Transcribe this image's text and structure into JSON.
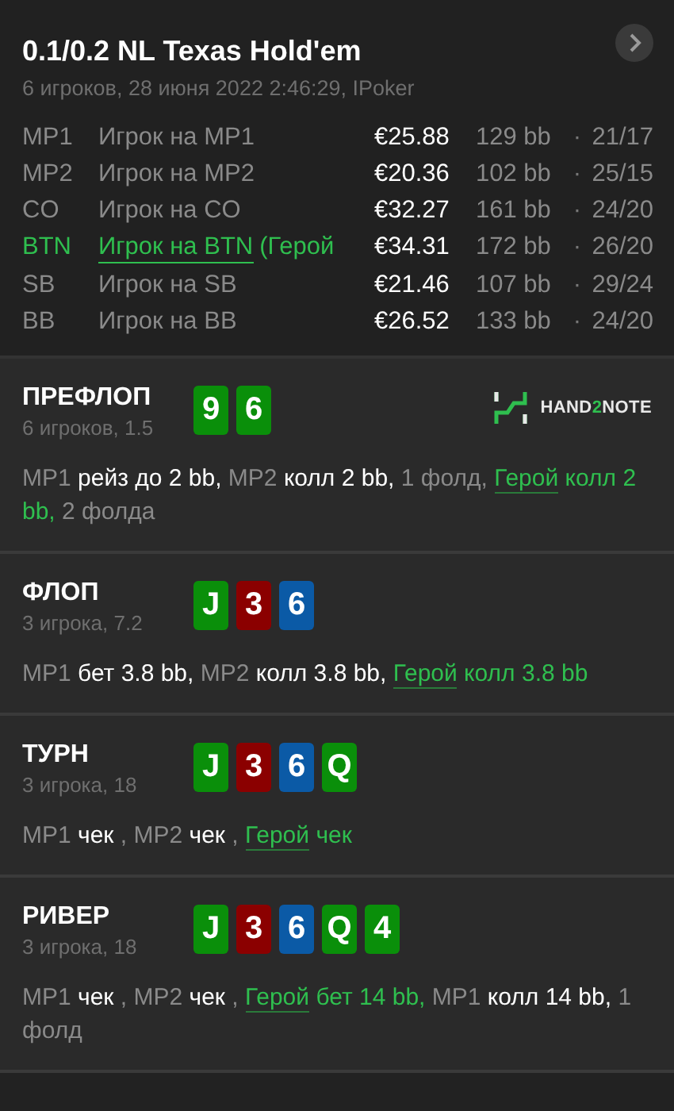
{
  "header": {
    "title": "0.1/0.2 NL Texas Hold'em",
    "subtitle": "6 игроков, 28 июня 2022 2:46:29, IPoker"
  },
  "players": [
    {
      "position": "MP1",
      "name": "Игрок на MP1",
      "hero": false,
      "stack": "€25.88",
      "bb": "129 bb",
      "sep": "·",
      "stats": "21/17"
    },
    {
      "position": "MP2",
      "name": "Игрок на MP2",
      "hero": false,
      "stack": "€20.36",
      "bb": "102 bb",
      "sep": "·",
      "stats": "25/15"
    },
    {
      "position": "CO",
      "name": "Игрок на CO",
      "hero": false,
      "stack": "€32.27",
      "bb": "161 bb",
      "sep": "·",
      "stats": "24/20"
    },
    {
      "position": "BTN",
      "name": "Игрок на BTN",
      "tag": "(Герой",
      "hero": true,
      "stack": "€34.31",
      "bb": "172 bb",
      "sep": "·",
      "stats": "26/20"
    },
    {
      "position": "SB",
      "name": "Игрок на SB",
      "hero": false,
      "stack": "€21.46",
      "bb": "107 bb",
      "sep": "·",
      "stats": "29/24"
    },
    {
      "position": "BB",
      "name": "Игрок на BB",
      "hero": false,
      "stack": "€26.52",
      "bb": "133 bb",
      "sep": "·",
      "stats": "24/20"
    }
  ],
  "streets": [
    {
      "title": "ПРЕФЛОП",
      "subtitle": "6 игроков, 1.5",
      "cards": [
        {
          "rank": "9",
          "color": "#0a8f0a"
        },
        {
          "rank": "6",
          "color": "#0a8f0a"
        }
      ],
      "logo": {
        "prefix": "HAND",
        "accent": "2",
        "suffix": "NOTE"
      },
      "actions": [
        {
          "kind": "seat",
          "text": "MP1 "
        },
        {
          "kind": "move",
          "text": "рейз до 2 bb,"
        },
        {
          "kind": "seat",
          "text": " MP2 "
        },
        {
          "kind": "move",
          "text": "колл 2 bb,"
        },
        {
          "kind": "fold",
          "text": " 1 фолд, "
        },
        {
          "kind": "hero-link",
          "text": "Герой"
        },
        {
          "kind": "hero",
          "text": " колл 2 bb,"
        },
        {
          "kind": "fold",
          "text": " 2 фолда"
        }
      ]
    },
    {
      "title": "ФЛОП",
      "subtitle": "3 игрока, 7.2",
      "cards": [
        {
          "rank": "J",
          "color": "#0a8f0a"
        },
        {
          "rank": "3",
          "color": "#8b0000"
        },
        {
          "rank": "6",
          "color": "#0b5aa6"
        }
      ],
      "actions": [
        {
          "kind": "seat",
          "text": "MP1 "
        },
        {
          "kind": "move",
          "text": "бет 3.8 bb,"
        },
        {
          "kind": "seat",
          "text": " MP2 "
        },
        {
          "kind": "move",
          "text": "колл 3.8 bb, "
        },
        {
          "kind": "hero-link",
          "text": "Герой"
        },
        {
          "kind": "hero",
          "text": " колл 3.8 bb"
        }
      ]
    },
    {
      "title": "ТУРН",
      "subtitle": "3 игрока, 18",
      "cards": [
        {
          "rank": "J",
          "color": "#0a8f0a"
        },
        {
          "rank": "3",
          "color": "#8b0000"
        },
        {
          "rank": "6",
          "color": "#0b5aa6"
        },
        {
          "rank": "Q",
          "color": "#0a8f0a"
        }
      ],
      "actions": [
        {
          "kind": "seat",
          "text": "MP1 "
        },
        {
          "kind": "move",
          "text": "чек "
        },
        {
          "kind": "seat",
          "text": ", MP2 "
        },
        {
          "kind": "move",
          "text": "чек "
        },
        {
          "kind": "seat",
          "text": ", "
        },
        {
          "kind": "hero-link",
          "text": "Герой"
        },
        {
          "kind": "hero",
          "text": " чек"
        }
      ]
    },
    {
      "title": "РИВЕР",
      "subtitle": "3 игрока, 18",
      "cards": [
        {
          "rank": "J",
          "color": "#0a8f0a"
        },
        {
          "rank": "3",
          "color": "#8b0000"
        },
        {
          "rank": "6",
          "color": "#0b5aa6"
        },
        {
          "rank": "Q",
          "color": "#0a8f0a"
        },
        {
          "rank": "4",
          "color": "#0a8f0a"
        }
      ],
      "actions": [
        {
          "kind": "seat",
          "text": "MP1 "
        },
        {
          "kind": "move",
          "text": "чек "
        },
        {
          "kind": "seat",
          "text": ", MP2 "
        },
        {
          "kind": "move",
          "text": "чек "
        },
        {
          "kind": "seat",
          "text": ", "
        },
        {
          "kind": "hero-link",
          "text": "Герой"
        },
        {
          "kind": "hero",
          "text": " бет 14 bb,"
        },
        {
          "kind": "seat",
          "text": " MP1 "
        },
        {
          "kind": "move",
          "text": "колл 14 bb,"
        },
        {
          "kind": "fold",
          "text": " 1 фолд"
        }
      ]
    }
  ]
}
